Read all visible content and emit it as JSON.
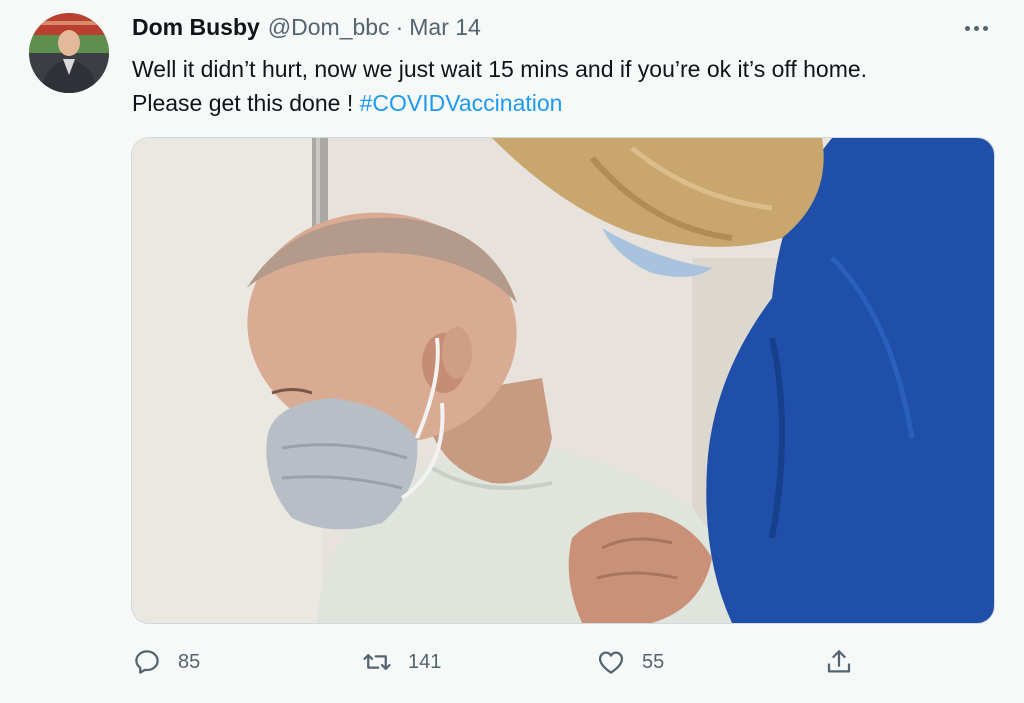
{
  "tweet": {
    "author_name": "Dom Busby",
    "author_handle": "@Dom_bbc",
    "separator": "·",
    "date": "Mar 14",
    "text_line1": "Well it didn’t hurt, now we just wait 15 mins and if you’re ok it’s off home.",
    "text_line2_prefix": "Please get this done ! ",
    "hashtag": "#COVIDVaccination"
  },
  "actions": {
    "reply_icon": "reply-icon",
    "reply_count": "85",
    "retweet_icon": "retweet-icon",
    "retweet_count": "141",
    "like_icon": "heart-icon",
    "like_count": "55",
    "share_icon": "share-icon"
  },
  "colors": {
    "background": "#f7f9f9",
    "text": "#0f1419",
    "secondary": "#536471",
    "link": "#1d9bf0",
    "scrubs": "#1f4fa8"
  }
}
